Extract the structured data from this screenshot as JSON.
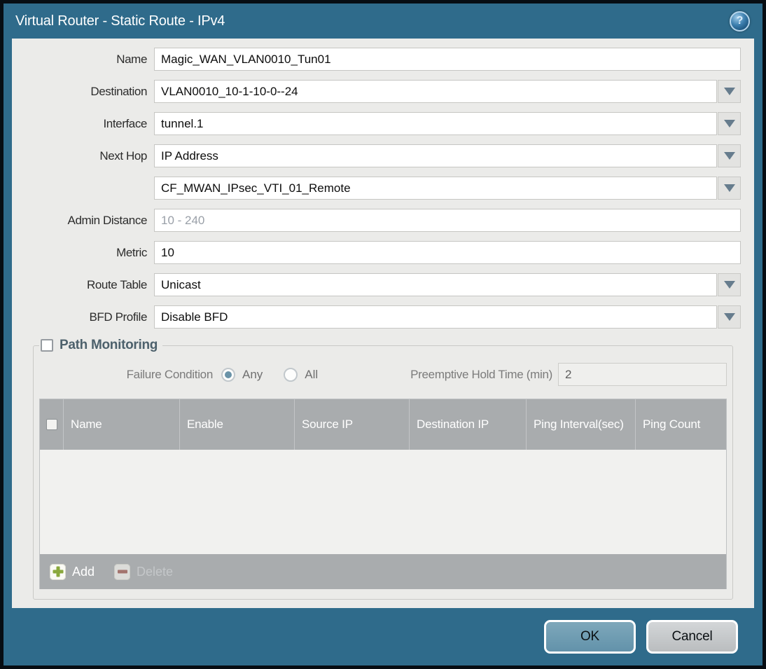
{
  "dialog": {
    "title": "Virtual Router - Static Route - IPv4"
  },
  "form": {
    "name": {
      "label": "Name",
      "value": "Magic_WAN_VLAN0010_Tun01"
    },
    "destination": {
      "label": "Destination",
      "value": "VLAN0010_10-1-10-0--24"
    },
    "interface": {
      "label": "Interface",
      "value": "tunnel.1"
    },
    "next_hop": {
      "label": "Next Hop",
      "value": "IP Address"
    },
    "next_hop_address": {
      "value": "CF_MWAN_IPsec_VTI_01_Remote"
    },
    "admin_distance": {
      "label": "Admin Distance",
      "placeholder": "10 - 240"
    },
    "metric": {
      "label": "Metric",
      "value": "10"
    },
    "route_table": {
      "label": "Route Table",
      "value": "Unicast"
    },
    "bfd_profile": {
      "label": "BFD Profile",
      "value": "Disable BFD"
    }
  },
  "path_monitoring": {
    "legend": "Path Monitoring",
    "checked": false,
    "failure_condition": {
      "label": "Failure Condition",
      "options": [
        {
          "label": "Any",
          "selected": true
        },
        {
          "label": "All",
          "selected": false
        }
      ]
    },
    "preemptive_hold": {
      "label": "Preemptive Hold Time (min)",
      "value": "2"
    },
    "table": {
      "columns": [
        "Name",
        "Enable",
        "Source IP",
        "Destination IP",
        "Ping Interval(sec)",
        "Ping Count"
      ],
      "rows": []
    },
    "toolbar": {
      "add": "Add",
      "delete": "Delete",
      "delete_enabled": false
    }
  },
  "footer": {
    "ok": "OK",
    "cancel": "Cancel"
  },
  "colors": {
    "titlebar": "#2F6B8B",
    "body_background": "#EBEBE9",
    "table_header": "#A9ACAE",
    "radio_selected": "#6A93A8",
    "ok_button": "#6FA0B6",
    "cancel_button": "#C5C8CA",
    "add_icon_green": "#8AA83C",
    "delete_icon_red": "#A2675F",
    "legend_text": "#4D616C"
  }
}
